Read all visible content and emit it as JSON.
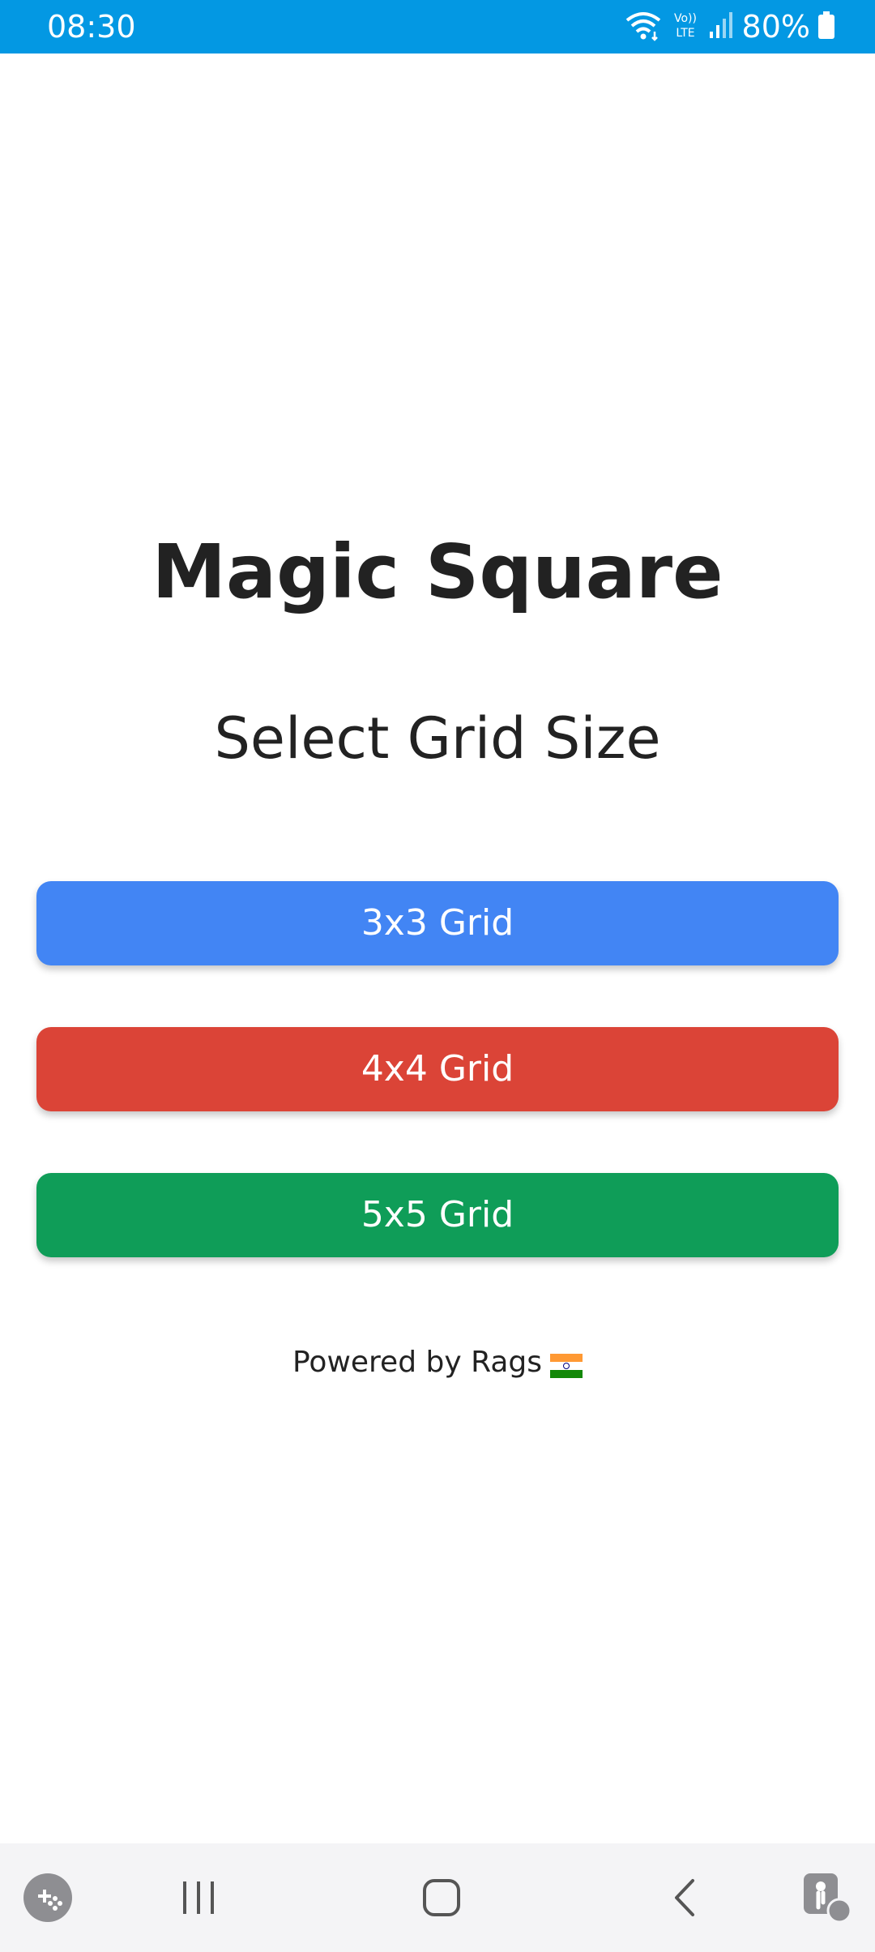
{
  "status_bar": {
    "time": "08:30",
    "battery_text": "80%",
    "icons": [
      "wifi-icon",
      "volte-icon",
      "signal-icon",
      "battery-icon"
    ],
    "background": "#0398e3"
  },
  "main": {
    "title": "Magic Square",
    "subtitle": "Select Grid Size",
    "buttons": [
      {
        "label": "3x3 Grid",
        "color": "#4285f4"
      },
      {
        "label": "4x4 Grid",
        "color": "#db4437"
      },
      {
        "label": "5x5 Grid",
        "color": "#0f9d58"
      }
    ],
    "footer": "Powered by Rags",
    "footer_icon": "india-flag-icon"
  },
  "nav_bar": {
    "icons": [
      "game-launcher-icon",
      "recent-apps-icon",
      "home-icon",
      "back-icon",
      "accessibility-icon"
    ]
  }
}
